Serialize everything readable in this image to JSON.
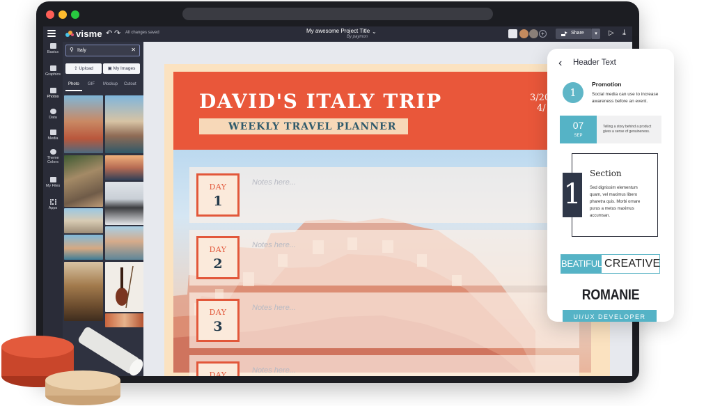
{
  "window": {
    "controls": [
      "close",
      "minimize",
      "maximize"
    ]
  },
  "topbar": {
    "logo": "visme",
    "autosave_status": "All changes saved",
    "project_title": "My awesome Project Title",
    "project_author": "By paymon",
    "share_label": "Share",
    "icons": [
      "hamburger-icon",
      "undo-icon",
      "redo-icon",
      "notification-icon",
      "add-collaborator-icon",
      "play-icon",
      "download-icon"
    ]
  },
  "rail": {
    "items": [
      {
        "label": "Basics",
        "icon": "basics-icon"
      },
      {
        "label": "Graphics",
        "icon": "graphics-icon"
      },
      {
        "label": "Photos",
        "icon": "photos-icon",
        "active": true
      },
      {
        "label": "Data",
        "icon": "data-icon"
      },
      {
        "label": "Media",
        "icon": "media-icon"
      },
      {
        "label": "Theme Colors",
        "icon": "palette-icon"
      },
      {
        "label": "My Files",
        "icon": "folder-icon"
      },
      {
        "label": "Apps",
        "icon": "apps-icon"
      }
    ]
  },
  "panel": {
    "search_value": "Italy",
    "upload_label": "Upload",
    "my_images_label": "My Images",
    "tabs": [
      "Photo",
      "GIF",
      "Mockup",
      "Cutout"
    ],
    "active_tab": "Photo"
  },
  "canvas": {
    "title": "DAVID'S ITALY TRIP",
    "date_line1": "3/20",
    "date_line2": "4/",
    "subtitle": "WEEKLY TRAVEL PLANNER",
    "days": [
      {
        "label": "DAY",
        "num": "1",
        "notes": "Notes here..."
      },
      {
        "label": "DAY",
        "num": "2",
        "notes": "Notes here..."
      },
      {
        "label": "DAY",
        "num": "3",
        "notes": "Notes here..."
      },
      {
        "label": "DAY",
        "num": "",
        "notes": "Notes here..."
      }
    ],
    "colors": {
      "accent": "#e9573a",
      "navy": "#233a4a",
      "cream": "#fbe2c0"
    }
  },
  "phone": {
    "header": "Header Text",
    "promo_num": "1",
    "promo_title": "Promotion",
    "promo_text": "Social media can use to increase awareness before an event.",
    "date_day": "07",
    "date_month": "SEP",
    "date_text": "Telling a story behind a product gives a sense of genuineness.",
    "section_num": "1",
    "section_title": "Section",
    "section_text": "Sed dignissim elementum quam, vel maximus libero pharetra quis. Morbi ornare purus a metus maximus accumsan.",
    "creative_a": "BEATIFUL",
    "creative_b": "CREATIVE",
    "romanie": "ROMANIE",
    "ui_dev": "UI/UX DEVELOPER",
    "colors": {
      "teal": "#55b3c6"
    }
  }
}
